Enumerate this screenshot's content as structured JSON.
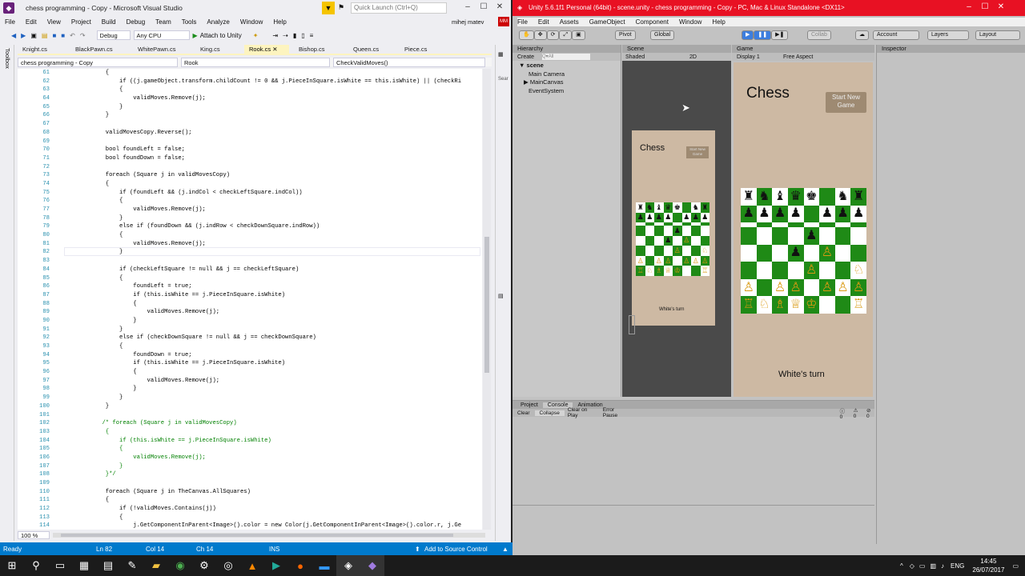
{
  "vs": {
    "title": "chess programming - Copy - Microsoft Visual Studio",
    "quick_launch": "Quick Launch (Ctrl+Q)",
    "user": "mihej matev",
    "menu": [
      "File",
      "Edit",
      "View",
      "Project",
      "Build",
      "Debug",
      "Team",
      "Tools",
      "Analyze",
      "Window",
      "Help"
    ],
    "config": "Debug",
    "platform": "Any CPU",
    "attach": "Attach to Unity",
    "tabs": [
      "Knight.cs",
      "BlackPawn.cs",
      "WhitePawn.cs",
      "King.cs",
      "Rook.cs",
      "Bishop.cs",
      "Queen.cs",
      "Piece.cs"
    ],
    "nav": {
      "project": "chess programming - Copy",
      "class": "Rook",
      "method": "CheckValidMoves()"
    },
    "sidebar_left": "Toolbox",
    "sidebar_right": "Solution Explorer",
    "code_lines": [
      {
        "n": "61",
        "t": "            {"
      },
      {
        "n": "62",
        "t": "                if ((j.gameObject.transform.childCount != 0 && j.PieceInSquare.isWhite == this.isWhite) || (checkRi"
      },
      {
        "n": "63",
        "t": "                {"
      },
      {
        "n": "64",
        "t": "                    validMoves.Remove(j);"
      },
      {
        "n": "65",
        "t": "                }"
      },
      {
        "n": "66",
        "t": "            }"
      },
      {
        "n": "67",
        "t": ""
      },
      {
        "n": "68",
        "t": "            validMovesCopy.Reverse();"
      },
      {
        "n": "69",
        "t": ""
      },
      {
        "n": "70",
        "t": "            bool foundLeft = false;"
      },
      {
        "n": "71",
        "t": "            bool foundDown = false;"
      },
      {
        "n": "72",
        "t": ""
      },
      {
        "n": "73",
        "t": "            foreach (Square j in validMovesCopy)"
      },
      {
        "n": "74",
        "t": "            {"
      },
      {
        "n": "75",
        "t": "                if (foundLeft && (j.indCol < checkLeftSquare.indCol))"
      },
      {
        "n": "76",
        "t": "                {"
      },
      {
        "n": "77",
        "t": "                    validMoves.Remove(j);"
      },
      {
        "n": "78",
        "t": "                }"
      },
      {
        "n": "79",
        "t": "                else if (foundDown && (j.indRow < checkDownSquare.indRow))"
      },
      {
        "n": "80",
        "t": "                {"
      },
      {
        "n": "81",
        "t": "                    validMoves.Remove(j);"
      },
      {
        "n": "82",
        "t": "                }"
      },
      {
        "n": "83",
        "t": ""
      },
      {
        "n": "84",
        "t": "                if (checkLeftSquare != null && j == checkLeftSquare)"
      },
      {
        "n": "85",
        "t": "                {"
      },
      {
        "n": "86",
        "t": "                    foundLeft = true;"
      },
      {
        "n": "87",
        "t": "                    if (this.isWhite == j.PieceInSquare.isWhite)"
      },
      {
        "n": "88",
        "t": "                    {"
      },
      {
        "n": "89",
        "t": "                        validMoves.Remove(j);"
      },
      {
        "n": "90",
        "t": "                    }"
      },
      {
        "n": "91",
        "t": "                }"
      },
      {
        "n": "92",
        "t": "                else if (checkDownSquare != null && j == checkDownSquare)"
      },
      {
        "n": "93",
        "t": "                {"
      },
      {
        "n": "94",
        "t": "                    foundDown = true;"
      },
      {
        "n": "95",
        "t": "                    if (this.isWhite == j.PieceInSquare.isWhite)"
      },
      {
        "n": "96",
        "t": "                    {"
      },
      {
        "n": "97",
        "t": "                        validMoves.Remove(j);"
      },
      {
        "n": "98",
        "t": "                    }"
      },
      {
        "n": "99",
        "t": "                }"
      },
      {
        "n": "100",
        "t": "            }"
      },
      {
        "n": "101",
        "t": ""
      },
      {
        "n": "102",
        "t": "           /* foreach (Square j in validMovesCopy)"
      },
      {
        "n": "103",
        "t": "            {"
      },
      {
        "n": "104",
        "t": "                if (this.isWhite == j.PieceInSquare.isWhite)"
      },
      {
        "n": "105",
        "t": "                {"
      },
      {
        "n": "106",
        "t": "                    validMoves.Remove(j);"
      },
      {
        "n": "107",
        "t": "                }"
      },
      {
        "n": "108",
        "t": "            }*/"
      },
      {
        "n": "109",
        "t": ""
      },
      {
        "n": "110",
        "t": "            foreach (Square j in TheCanvas.AllSquares)"
      },
      {
        "n": "111",
        "t": "            {"
      },
      {
        "n": "112",
        "t": "                if (!validMoves.Contains(j))"
      },
      {
        "n": "113",
        "t": "                {"
      },
      {
        "n": "114",
        "t": "                    j.GetComponentInParent<Image>().color = new Color(j.GetComponentInParent<Image>().color.r, j.Ge"
      }
    ],
    "zoom": "100 %",
    "status": {
      "ready": "Ready",
      "ln": "Ln 82",
      "col": "Col 14",
      "ch": "Ch 14",
      "ins": "INS",
      "source_control": "Add to Source Control"
    }
  },
  "unity": {
    "title": "Unity 5.6.1f1 Personal (64bit) - scene.unity - chess programming - Copy - PC, Mac & Linux Standalone <DX11>",
    "menu": [
      "File",
      "Edit",
      "Assets",
      "GameObject",
      "Component",
      "Window",
      "Help"
    ],
    "pivot": "Pivot",
    "global": "Global",
    "collab": "Collab",
    "account": "Account",
    "layers": "Layers",
    "layout": "Layout",
    "hierarchy": {
      "title": "Hierarchy",
      "create": "Create",
      "search": "Q▾All",
      "scene": "scene",
      "items": [
        "Main Camera",
        "MainCanvas",
        "EventSystem"
      ]
    },
    "scene_tab": {
      "title": "Scene",
      "shading": "Shaded",
      "mode": "2D"
    },
    "game_tab": {
      "title": "Game",
      "display": "Display 1",
      "aspect": "Free Aspect"
    },
    "inspector": "Inspector",
    "game": {
      "title": "Chess",
      "button": "Start New Game",
      "turn": "White's turn"
    },
    "console": {
      "tabs": [
        "Project",
        "Console",
        "Animation"
      ],
      "buttons": [
        "Clear",
        "Collapse",
        "Clear on Play",
        "Error Pause"
      ],
      "counts": [
        "0",
        "0",
        "0"
      ]
    },
    "board": [
      [
        "♜",
        "♞",
        "♝",
        "♛",
        "♚",
        "",
        "♞",
        "♜"
      ],
      [
        "♟",
        "♟",
        "♟",
        "♟",
        "",
        "♟",
        "♟",
        "♟"
      ],
      [
        "",
        "",
        "",
        "",
        "",
        "",
        "",
        ""
      ],
      [
        "",
        "",
        "",
        "",
        "♟",
        "",
        "",
        ""
      ],
      [
        "",
        "",
        "",
        "♟",
        "",
        "♙",
        "",
        ""
      ],
      [
        "",
        "",
        "",
        "",
        "♙",
        "",
        "",
        "♘"
      ],
      [
        "♙",
        "",
        "♙",
        "♙",
        "",
        "♙",
        "♙",
        "♙"
      ],
      [
        "♖",
        "♘",
        "♗",
        "♕",
        "♔",
        "",
        "",
        "♖"
      ]
    ]
  },
  "taskbar": {
    "lang": "ENG",
    "time": "14:45",
    "date": "26/07/2017"
  }
}
